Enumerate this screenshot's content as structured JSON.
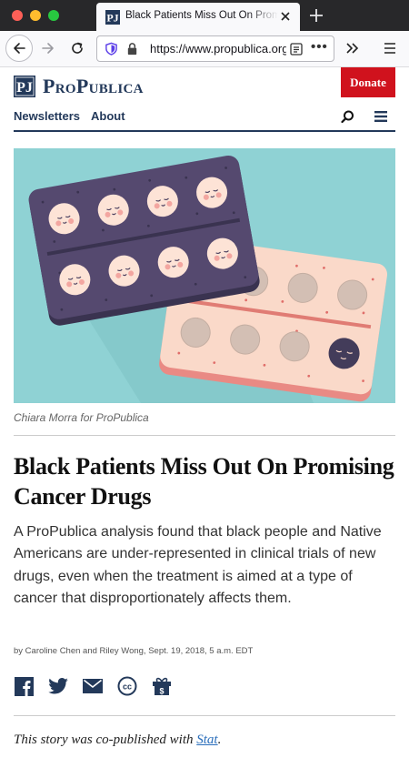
{
  "browser": {
    "tab_title": "Black Patients Miss Out On Promising Cancer Drugs",
    "url": "https://www.propublica.org",
    "page_actions_label": "•••",
    "favicon_icon": "propublica-favicon"
  },
  "site": {
    "brand_name": "ProPublica",
    "donate_label": "Donate",
    "nav": [
      "Newsletters",
      "About"
    ],
    "brand_color": "#23395a",
    "donate_color": "#d0121d"
  },
  "article": {
    "caption": "Chiara Morra for ProPublica",
    "headline": "Black Patients Miss Out On Promising Cancer Drugs",
    "dek": "A ProPublica analysis found that black people and Native Americans are under-represented in clinical trials of new drugs, even when the treatment is aimed at a type of cancer that disproportionately affects them.",
    "byline": "by Caroline Chen and Riley Wong, Sept. 19, 2018, 5 a.m. EDT",
    "share_icons": [
      "facebook-icon",
      "twitter-icon",
      "email-icon",
      "creative-commons-icon",
      "gift-icon"
    ],
    "copub_prefix": "This story was co-published with ",
    "copub_link": "Stat",
    "copub_suffix": "."
  }
}
